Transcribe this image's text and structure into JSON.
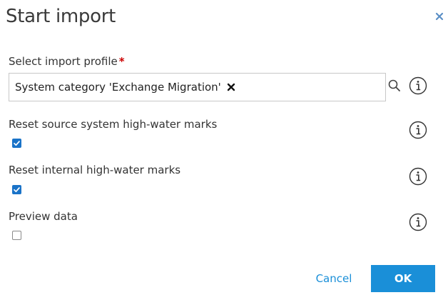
{
  "dialog": {
    "title": "Start import",
    "close_icon": "close-icon"
  },
  "profile": {
    "label": "Select import profile",
    "required_marker": "*",
    "selected_value": "System category 'Exchange Migration'",
    "remove_icon": "close-icon",
    "search_icon": "search-icon",
    "info_icon": "info-icon"
  },
  "options": [
    {
      "label": "Reset source system high-water marks",
      "checked": true,
      "info_icon": "info-icon"
    },
    {
      "label": "Reset internal high-water marks",
      "checked": true,
      "info_icon": "info-icon"
    },
    {
      "label": "Preview data",
      "checked": false,
      "info_icon": "info-icon"
    }
  ],
  "footer": {
    "cancel_label": "Cancel",
    "ok_label": "OK"
  },
  "colors": {
    "accent": "#1a8fd8",
    "checkbox_checked": "#1a73c8",
    "required": "#cc0000",
    "close_icon": "#5b8fc6"
  }
}
